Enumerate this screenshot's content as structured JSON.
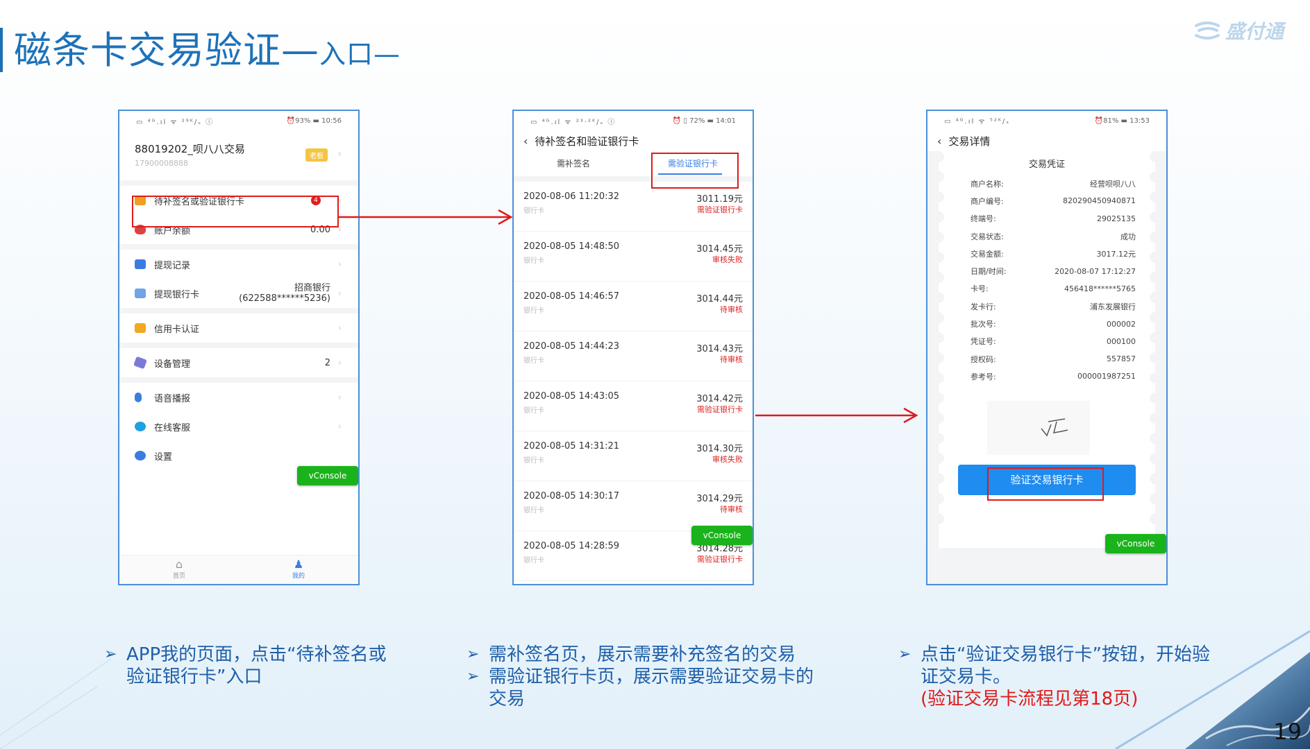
{
  "slide": {
    "title_main": "磁条卡交易验证—",
    "title_sub": "入口—",
    "logo_text": "盛付通",
    "page_number": "19"
  },
  "phone1": {
    "status_left": "▭ ⁴ᴳ.ıl ᯤ ²⁹ᴷ/ₛ ⓘ",
    "status_right": "⏰93% ▬ 10:56",
    "merchant_name": "88019202_呗八八交易",
    "merchant_id": "17900008888",
    "merchant_tag": "老板",
    "rows": [
      {
        "label": "待补签名或验证银行卡",
        "value": "",
        "badge": "4",
        "icon_color": "#f0a020"
      },
      {
        "label": "账户余额",
        "value": "0.00",
        "icon_color": "#e04040"
      },
      {
        "label": "提现记录",
        "value": "",
        "icon_color": "#3a7de0"
      },
      {
        "label": "提现银行卡",
        "value": "招商银行\n(622588******5236)",
        "icon_color": "#3a7de0"
      },
      {
        "label": "信用卡认证",
        "value": "",
        "icon_color": "#f5a623"
      },
      {
        "label": "设备管理",
        "value": "2",
        "icon_color": "#7b7bd6"
      },
      {
        "label": "语音播报",
        "value": "",
        "icon_color": "#3a7de0"
      },
      {
        "label": "在线客服",
        "value": "",
        "icon_color": "#1fa0e0"
      },
      {
        "label": "设置",
        "value": "",
        "icon_color": "#3a7de0"
      }
    ],
    "tabbar": [
      {
        "label": "首页",
        "glyph": "⌂"
      },
      {
        "label": "我的",
        "glyph": "♟"
      }
    ],
    "vconsole": "vConsole"
  },
  "phone2": {
    "status_left": "▭ ⁴ᴳ.ıl ᯤ ²³·²ᴷ/ₛ ⓘ",
    "status_right": "⏰ ▯ 72% ▬ 14:01",
    "nav_title": "待补签名和验证银行卡",
    "tabs": [
      "需补签名",
      "需验证银行卡"
    ],
    "transactions": [
      {
        "datetime": "2020-08-06 11:20:32",
        "amount": "3011.19元",
        "card": "银行卡",
        "status": "需验证银行卡"
      },
      {
        "datetime": "2020-08-05 14:48:50",
        "amount": "3014.45元",
        "card": "银行卡",
        "status": "审核失败"
      },
      {
        "datetime": "2020-08-05 14:46:57",
        "amount": "3014.44元",
        "card": "银行卡",
        "status": "待审核"
      },
      {
        "datetime": "2020-08-05 14:44:23",
        "amount": "3014.43元",
        "card": "银行卡",
        "status": "待审核"
      },
      {
        "datetime": "2020-08-05 14:43:05",
        "amount": "3014.42元",
        "card": "银行卡",
        "status": "需验证银行卡"
      },
      {
        "datetime": "2020-08-05 14:31:21",
        "amount": "3014.30元",
        "card": "银行卡",
        "status": "审核失败"
      },
      {
        "datetime": "2020-08-05 14:30:17",
        "amount": "3014.29元",
        "card": "银行卡",
        "status": "待审核"
      },
      {
        "datetime": "2020-08-05 14:28:59",
        "amount": "3014.28元",
        "card": "银行卡",
        "status": "需验证银行卡"
      }
    ],
    "vconsole": "vConsole"
  },
  "phone3": {
    "status_left": "▭ ⁴ᴳ.ıl ᯤ ⁵²ᴷ/ₛ",
    "status_right": "⏰81% ▬ 13:53",
    "nav_title": "交易详情",
    "receipt_title": "交易凭证",
    "fields": [
      {
        "label": "商户名称:",
        "value": "经营呗呗八八"
      },
      {
        "label": "商户编号:",
        "value": "820290450940871"
      },
      {
        "label": "终端号:",
        "value": "29025135"
      },
      {
        "label": "交易状态:",
        "value": "成功"
      },
      {
        "label": "交易金额:",
        "value": "3017.12元"
      },
      {
        "label": "日期/时间:",
        "value": "2020-08-07 17:12:27"
      },
      {
        "label": "卡号:",
        "value": "456418******5765"
      },
      {
        "label": "发卡行:",
        "value": "浦东发展银行"
      },
      {
        "label": "批次号:",
        "value": "000002"
      },
      {
        "label": "凭证号:",
        "value": "000100"
      },
      {
        "label": "授权码:",
        "value": "557857"
      },
      {
        "label": "参考号:",
        "value": "000001987251"
      }
    ],
    "verify_button": "验证交易银行卡",
    "vconsole": "vConsole"
  },
  "captions": {
    "c1": [
      "APP我的页面，点击“待补签名或验证银行卡”入口"
    ],
    "c2": [
      "需补签名页，展示需要补充签名的交易",
      "需验证银行卡页，展示需要验证交易卡的交易"
    ],
    "c3": [
      "点击“验证交易银行卡”按钮，开始验证交易卡。"
    ],
    "c3_note": "(验证交易卡流程见第18页)"
  },
  "colors": {
    "title_blue": "#1e72b8",
    "highlight_red": "#e01a1a",
    "primary_blue": "#1f8cf0",
    "vconsole_green": "#1bb31b"
  }
}
